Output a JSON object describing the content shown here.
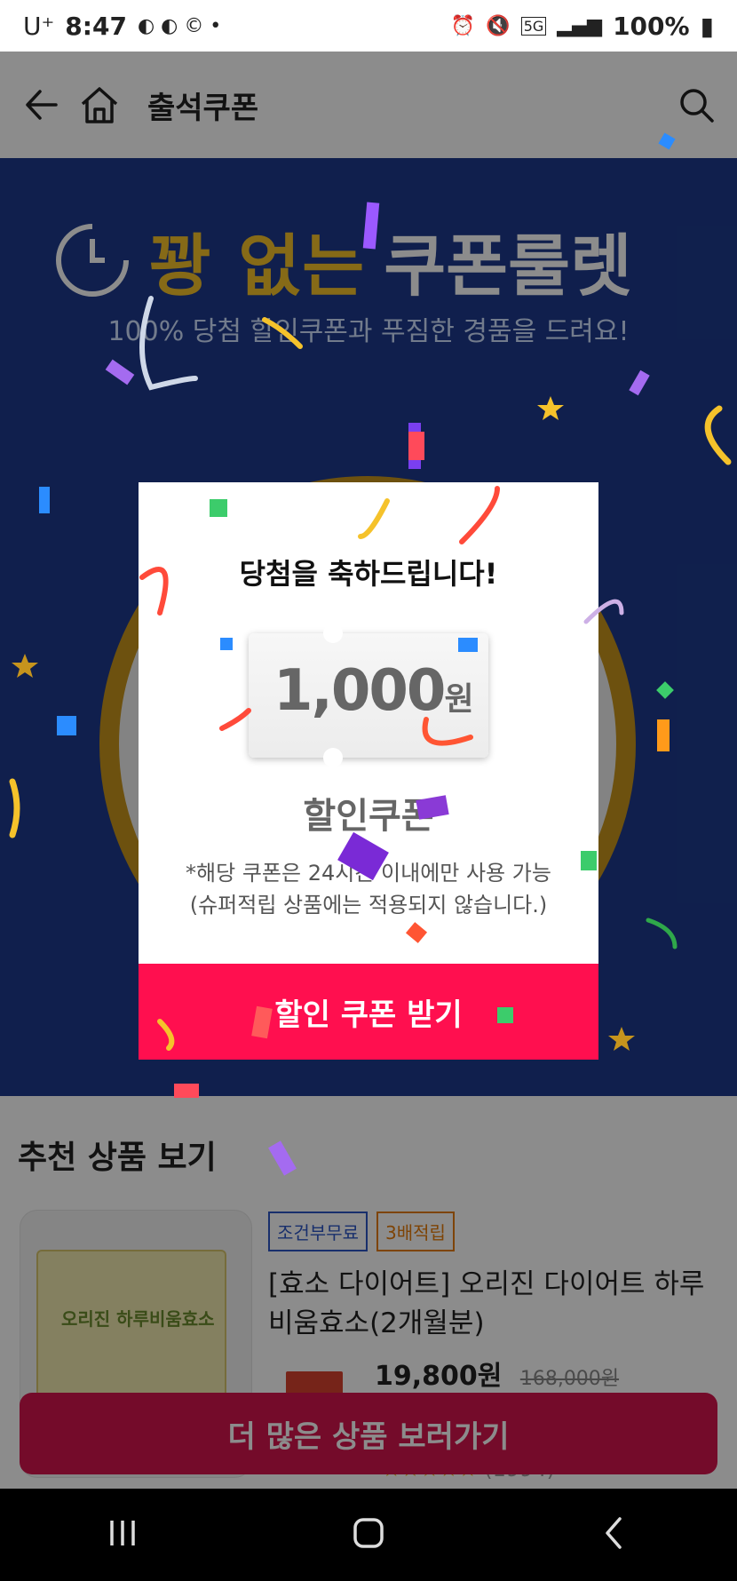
{
  "status_bar": {
    "carrier": "U⁺",
    "time": "8:47",
    "network": "5G",
    "battery": "100%"
  },
  "app_bar": {
    "title": "출석쿠폰"
  },
  "hero": {
    "title_clock_label": "24",
    "title_part1": "꽝 없는",
    "title_part2": "쿠폰룰렛",
    "subtitle": "100% 당첨 할인쿠폰과 푸짐한 경품을 드려요!"
  },
  "dialog": {
    "title": "당첨을 축하드립니다!",
    "coupon_amount": "1,000",
    "coupon_unit": "원",
    "coupon_label": "할인쿠폰",
    "note_line1": "*해당 쿠폰은 24시간 이내에만 사용 가능",
    "note_line2": "(슈퍼적립 상품에는 적용되지 않습니다.)",
    "button_label": "할인 쿠폰 받기"
  },
  "recommend": {
    "section_title": "추천 상품 보기",
    "product": {
      "badges": [
        "조건부무료",
        "3배적립"
      ],
      "name": "[효소 다이어트] 오리진 다이어트 하루비움효소(2개월분)",
      "price": "19,800원",
      "original_price": "168,000원",
      "rating_count": "(1994)",
      "image_text": "오리진 하루비움효소"
    }
  },
  "more_button": {
    "label": "더 많은 상품 보러가기"
  },
  "colors": {
    "dialog_button": "#ff0f4f",
    "more_button": "#d3154e",
    "hero_bg": "#1e3a8c",
    "hero_title_yellow": "#f5c22b",
    "badge_blue": "#2d56c5",
    "badge_orange": "#e57d0b"
  },
  "icons": [
    "back-arrow-icon",
    "home-icon",
    "search-icon",
    "nav-recents-icon",
    "nav-home-icon",
    "nav-back-icon"
  ]
}
